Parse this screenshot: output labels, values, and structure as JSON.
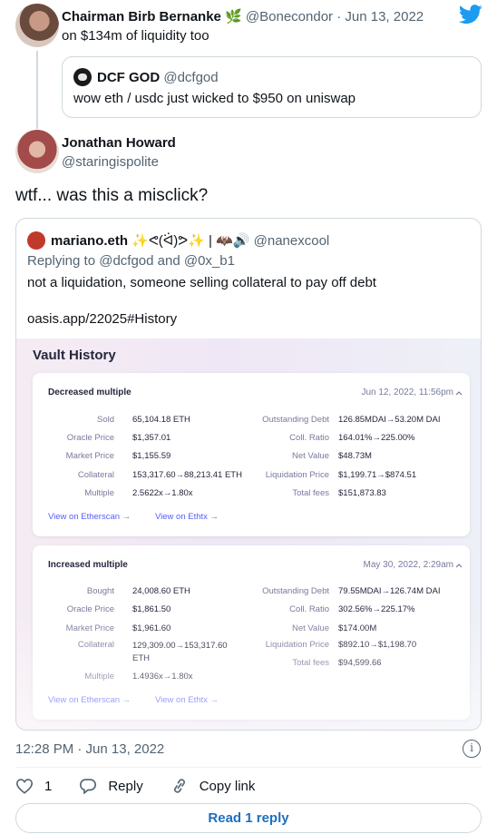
{
  "parent": {
    "name": "Chairman Birb Bernanke",
    "name_emoji": "🌿",
    "handle": "@Bonecondor",
    "date": "Jun 13, 2022",
    "separator": "·",
    "text": "on $134m of liquidity too"
  },
  "quote1": {
    "name": "DCF GOD",
    "handle": "@dcfgod",
    "text": "wow eth / usdc just wicked to $950 on uniswap"
  },
  "main": {
    "name": "Jonathan Howard",
    "handle": "@staringispolite",
    "text": "wtf... was this a misclick?"
  },
  "quote2": {
    "name": "mariano.eth",
    "name_decor": "✨ᕙ(ᐛ)ᕗ✨ | 🦇🔊",
    "handle": "@nanexcool",
    "replying": "Replying to @dcfgod and @0x_b1",
    "line1": "not a liquidation, someone selling collateral to pay off debt",
    "line2": "oasis.app/22025#History"
  },
  "vault": {
    "title": "Vault History",
    "cards": [
      {
        "title": "Decreased multiple",
        "date": "Jun 12, 2022, 11:56pm",
        "left_labels": [
          "Sold",
          "Oracle Price",
          "Market Price",
          "Collateral",
          "Multiple"
        ],
        "left_values": [
          "65,104.18 ETH",
          "$1,357.01",
          "$1,155.59",
          "153,317.60→88,213.41 ETH",
          "2.5622x→1.80x"
        ],
        "right_labels": [
          "Outstanding Debt",
          "Coll. Ratio",
          "Net Value",
          "Liquidation Price",
          "Total fees"
        ],
        "right_values": [
          "126.85MDAI→53.20M DAI",
          "164.01%→225.00%",
          "$48.73M",
          "$1,199.71→$874.51",
          "$151,873.83"
        ],
        "link1": "View on Etherscan →",
        "link2": "View on Ethtx →"
      },
      {
        "title": "Increased multiple",
        "date": "May 30, 2022, 2:29am",
        "left_labels": [
          "Bought",
          "Oracle Price",
          "Market Price",
          "Collateral",
          "Multiple"
        ],
        "left_values": [
          "24,008.60 ETH",
          "$1,861.50",
          "$1,961.60",
          "129,309.00→153,317.60 ETH",
          "1.4936x→1.80x"
        ],
        "right_labels": [
          "Outstanding Debt",
          "Coll. Ratio",
          "Net Value",
          "Liquidation Price",
          "Total fees"
        ],
        "right_values": [
          "79.55MDAI→126.74M DAI",
          "302.56%→225.17%",
          "$174.00M",
          "$892.10→$1,198.70",
          "$94,599.66"
        ],
        "link1": "View on Etherscan →",
        "link2": "View on Ethtx →"
      }
    ]
  },
  "footer": {
    "timestamp": "12:28 PM · Jun 13, 2022",
    "likes": "1",
    "reply_label": "Reply",
    "copy_label": "Copy link",
    "read_label": "Read 1 reply"
  },
  "colors": {
    "twitter_blue": "#1d9bf0",
    "link_purple": "#575cfe",
    "muted": "#536471"
  }
}
